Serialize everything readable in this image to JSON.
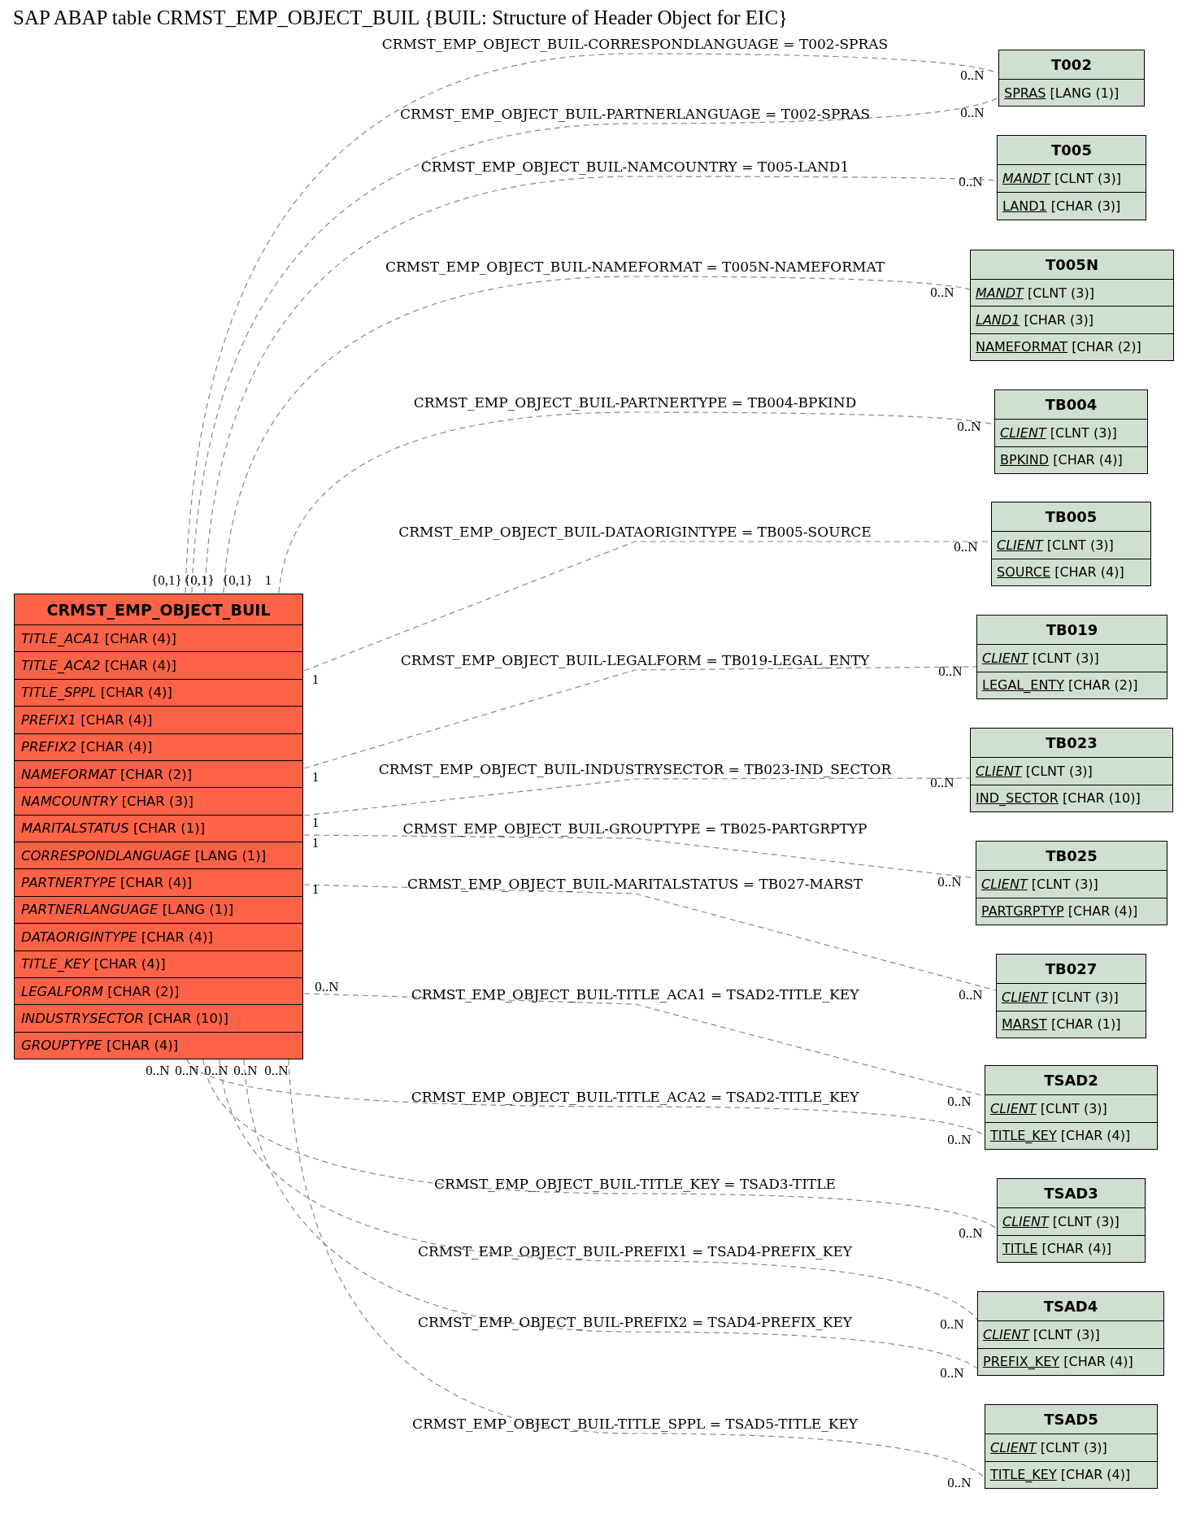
{
  "title": "SAP ABAP table CRMST_EMP_OBJECT_BUIL {BUIL: Structure of Header Object for EIC}",
  "main_table": {
    "name": "CRMST_EMP_OBJECT_BUIL",
    "fields": [
      {
        "name": "TITLE_ACA1",
        "type": "[CHAR (4)]",
        "italic": true,
        "underlined": false
      },
      {
        "name": "TITLE_ACA2",
        "type": "[CHAR (4)]",
        "italic": true,
        "underlined": false
      },
      {
        "name": "TITLE_SPPL",
        "type": "[CHAR (4)]",
        "italic": true,
        "underlined": false
      },
      {
        "name": "PREFIX1",
        "type": "[CHAR (4)]",
        "italic": true,
        "underlined": false
      },
      {
        "name": "PREFIX2",
        "type": "[CHAR (4)]",
        "italic": true,
        "underlined": false
      },
      {
        "name": "NAMEFORMAT",
        "type": "[CHAR (2)]",
        "italic": true,
        "underlined": false
      },
      {
        "name": "NAMCOUNTRY",
        "type": "[CHAR (3)]",
        "italic": true,
        "underlined": false
      },
      {
        "name": "MARITALSTATUS",
        "type": "[CHAR (1)]",
        "italic": true,
        "underlined": false
      },
      {
        "name": "CORRESPONDLANGUAGE",
        "type": "[LANG (1)]",
        "italic": true,
        "underlined": false
      },
      {
        "name": "PARTNERTYPE",
        "type": "[CHAR (4)]",
        "italic": true,
        "underlined": false
      },
      {
        "name": "PARTNERLANGUAGE",
        "type": "[LANG (1)]",
        "italic": true,
        "underlined": false
      },
      {
        "name": "DATAORIGINTYPE",
        "type": "[CHAR (4)]",
        "italic": true,
        "underlined": false
      },
      {
        "name": "TITLE_KEY",
        "type": "[CHAR (4)]",
        "italic": true,
        "underlined": false
      },
      {
        "name": "LEGALFORM",
        "type": "[CHAR (2)]",
        "italic": true,
        "underlined": false
      },
      {
        "name": "INDUSTRYSECTOR",
        "type": "[CHAR (10)]",
        "italic": true,
        "underlined": false
      },
      {
        "name": "GROUPTYPE",
        "type": "[CHAR (4)]",
        "italic": true,
        "underlined": false
      }
    ]
  },
  "tables": [
    {
      "name": "T002",
      "fields": [
        {
          "name": "SPRAS",
          "type": "[LANG (1)]",
          "italic": false,
          "underlined": true
        }
      ]
    },
    {
      "name": "T005",
      "fields": [
        {
          "name": "MANDT",
          "type": "[CLNT (3)]",
          "italic": true,
          "underlined": true
        },
        {
          "name": "LAND1",
          "type": "[CHAR (3)]",
          "italic": false,
          "underlined": true
        }
      ]
    },
    {
      "name": "T005N",
      "fields": [
        {
          "name": "MANDT",
          "type": "[CLNT (3)]",
          "italic": true,
          "underlined": true
        },
        {
          "name": "LAND1",
          "type": "[CHAR (3)]",
          "italic": true,
          "underlined": true
        },
        {
          "name": "NAMEFORMAT",
          "type": "[CHAR (2)]",
          "italic": false,
          "underlined": true
        }
      ]
    },
    {
      "name": "TB004",
      "fields": [
        {
          "name": "CLIENT",
          "type": "[CLNT (3)]",
          "italic": true,
          "underlined": true
        },
        {
          "name": "BPKIND",
          "type": "[CHAR (4)]",
          "italic": false,
          "underlined": true
        }
      ]
    },
    {
      "name": "TB005",
      "fields": [
        {
          "name": "CLIENT",
          "type": "[CLNT (3)]",
          "italic": true,
          "underlined": true
        },
        {
          "name": "SOURCE",
          "type": "[CHAR (4)]",
          "italic": false,
          "underlined": true
        }
      ]
    },
    {
      "name": "TB019",
      "fields": [
        {
          "name": "CLIENT",
          "type": "[CLNT (3)]",
          "italic": true,
          "underlined": true
        },
        {
          "name": "LEGAL_ENTY",
          "type": "[CHAR (2)]",
          "italic": false,
          "underlined": true
        }
      ]
    },
    {
      "name": "TB023",
      "fields": [
        {
          "name": "CLIENT",
          "type": "[CLNT (3)]",
          "italic": true,
          "underlined": true
        },
        {
          "name": "IND_SECTOR",
          "type": "[CHAR (10)]",
          "italic": false,
          "underlined": true
        }
      ]
    },
    {
      "name": "TB025",
      "fields": [
        {
          "name": "CLIENT",
          "type": "[CLNT (3)]",
          "italic": true,
          "underlined": true
        },
        {
          "name": "PARTGRPTYP",
          "type": "[CHAR (4)]",
          "italic": false,
          "underlined": true
        }
      ]
    },
    {
      "name": "TB027",
      "fields": [
        {
          "name": "CLIENT",
          "type": "[CLNT (3)]",
          "italic": true,
          "underlined": true
        },
        {
          "name": "MARST",
          "type": "[CHAR (1)]",
          "italic": false,
          "underlined": true
        }
      ]
    },
    {
      "name": "TSAD2",
      "fields": [
        {
          "name": "CLIENT",
          "type": "[CLNT (3)]",
          "italic": true,
          "underlined": true
        },
        {
          "name": "TITLE_KEY",
          "type": "[CHAR (4)]",
          "italic": false,
          "underlined": true
        }
      ]
    },
    {
      "name": "TSAD3",
      "fields": [
        {
          "name": "CLIENT",
          "type": "[CLNT (3)]",
          "italic": true,
          "underlined": true
        },
        {
          "name": "TITLE",
          "type": "[CHAR (4)]",
          "italic": false,
          "underlined": true
        }
      ]
    },
    {
      "name": "TSAD4",
      "fields": [
        {
          "name": "CLIENT",
          "type": "[CLNT (3)]",
          "italic": true,
          "underlined": true
        },
        {
          "name": "PREFIX_KEY",
          "type": "[CHAR (4)]",
          "italic": false,
          "underlined": true
        }
      ]
    },
    {
      "name": "TSAD5",
      "fields": [
        {
          "name": "CLIENT",
          "type": "[CLNT (3)]",
          "italic": true,
          "underlined": true
        },
        {
          "name": "TITLE_KEY",
          "type": "[CHAR (4)]",
          "italic": false,
          "underlined": true
        }
      ]
    }
  ],
  "relations": [
    {
      "label": "CRMST_EMP_OBJECT_BUIL-CORRESPONDLANGUAGE = T002-SPRAS",
      "source_cardinality": "{0,1}",
      "target_cardinality": "0..N"
    },
    {
      "label": "CRMST_EMP_OBJECT_BUIL-PARTNERLANGUAGE = T002-SPRAS",
      "source_cardinality": "{0,1}",
      "target_cardinality": "0..N"
    },
    {
      "label": "CRMST_EMP_OBJECT_BUIL-NAMCOUNTRY = T005-LAND1",
      "source_cardinality": "{0,1}",
      "target_cardinality": "0..N"
    },
    {
      "label": "CRMST_EMP_OBJECT_BUIL-NAMEFORMAT = T005N-NAMEFORMAT",
      "target_cardinality": "0..N"
    },
    {
      "label": "CRMST_EMP_OBJECT_BUIL-PARTNERTYPE = TB004-BPKIND",
      "source_cardinality": "1",
      "target_cardinality": "0..N"
    },
    {
      "label": "CRMST_EMP_OBJECT_BUIL-DATAORIGINTYPE = TB005-SOURCE",
      "source_cardinality": "1",
      "target_cardinality": "0..N"
    },
    {
      "label": "CRMST_EMP_OBJECT_BUIL-LEGALFORM = TB019-LEGAL_ENTY",
      "source_cardinality": "1",
      "target_cardinality": "0..N"
    },
    {
      "label": "CRMST_EMP_OBJECT_BUIL-INDUSTRYSECTOR = TB023-IND_SECTOR",
      "source_cardinality": "1",
      "target_cardinality": "0..N"
    },
    {
      "label": "CRMST_EMP_OBJECT_BUIL-GROUPTYPE = TB025-PARTGRPTYP",
      "source_cardinality": "1",
      "target_cardinality": "0..N"
    },
    {
      "label": "CRMST_EMP_OBJECT_BUIL-MARITALSTATUS = TB027-MARST",
      "source_cardinality": "1",
      "target_cardinality": "0..N"
    },
    {
      "label": "CRMST_EMP_OBJECT_BUIL-TITLE_ACA1 = TSAD2-TITLE_KEY",
      "source_cardinality": "0..N",
      "target_cardinality": "0..N"
    },
    {
      "label": "CRMST_EMP_OBJECT_BUIL-TITLE_ACA2 = TSAD2-TITLE_KEY",
      "source_cardinality": "0..N",
      "target_cardinality": "0..N"
    },
    {
      "label": "CRMST_EMP_OBJECT_BUIL-TITLE_KEY = TSAD3-TITLE",
      "source_cardinality": "0..N",
      "target_cardinality": "0..N"
    },
    {
      "label": "CRMST_EMP_OBJECT_BUIL-PREFIX1 = TSAD4-PREFIX_KEY",
      "source_cardinality": "0..N",
      "target_cardinality": "0..N"
    },
    {
      "label": "CRMST_EMP_OBJECT_BUIL-PREFIX2 = TSAD4-PREFIX_KEY",
      "source_cardinality": "0..N",
      "target_cardinality": "0..N"
    },
    {
      "label": "CRMST_EMP_OBJECT_BUIL-TITLE_SPPL = TSAD5-TITLE_KEY",
      "source_cardinality": "0..N",
      "target_cardinality": "0..N"
    }
  ]
}
